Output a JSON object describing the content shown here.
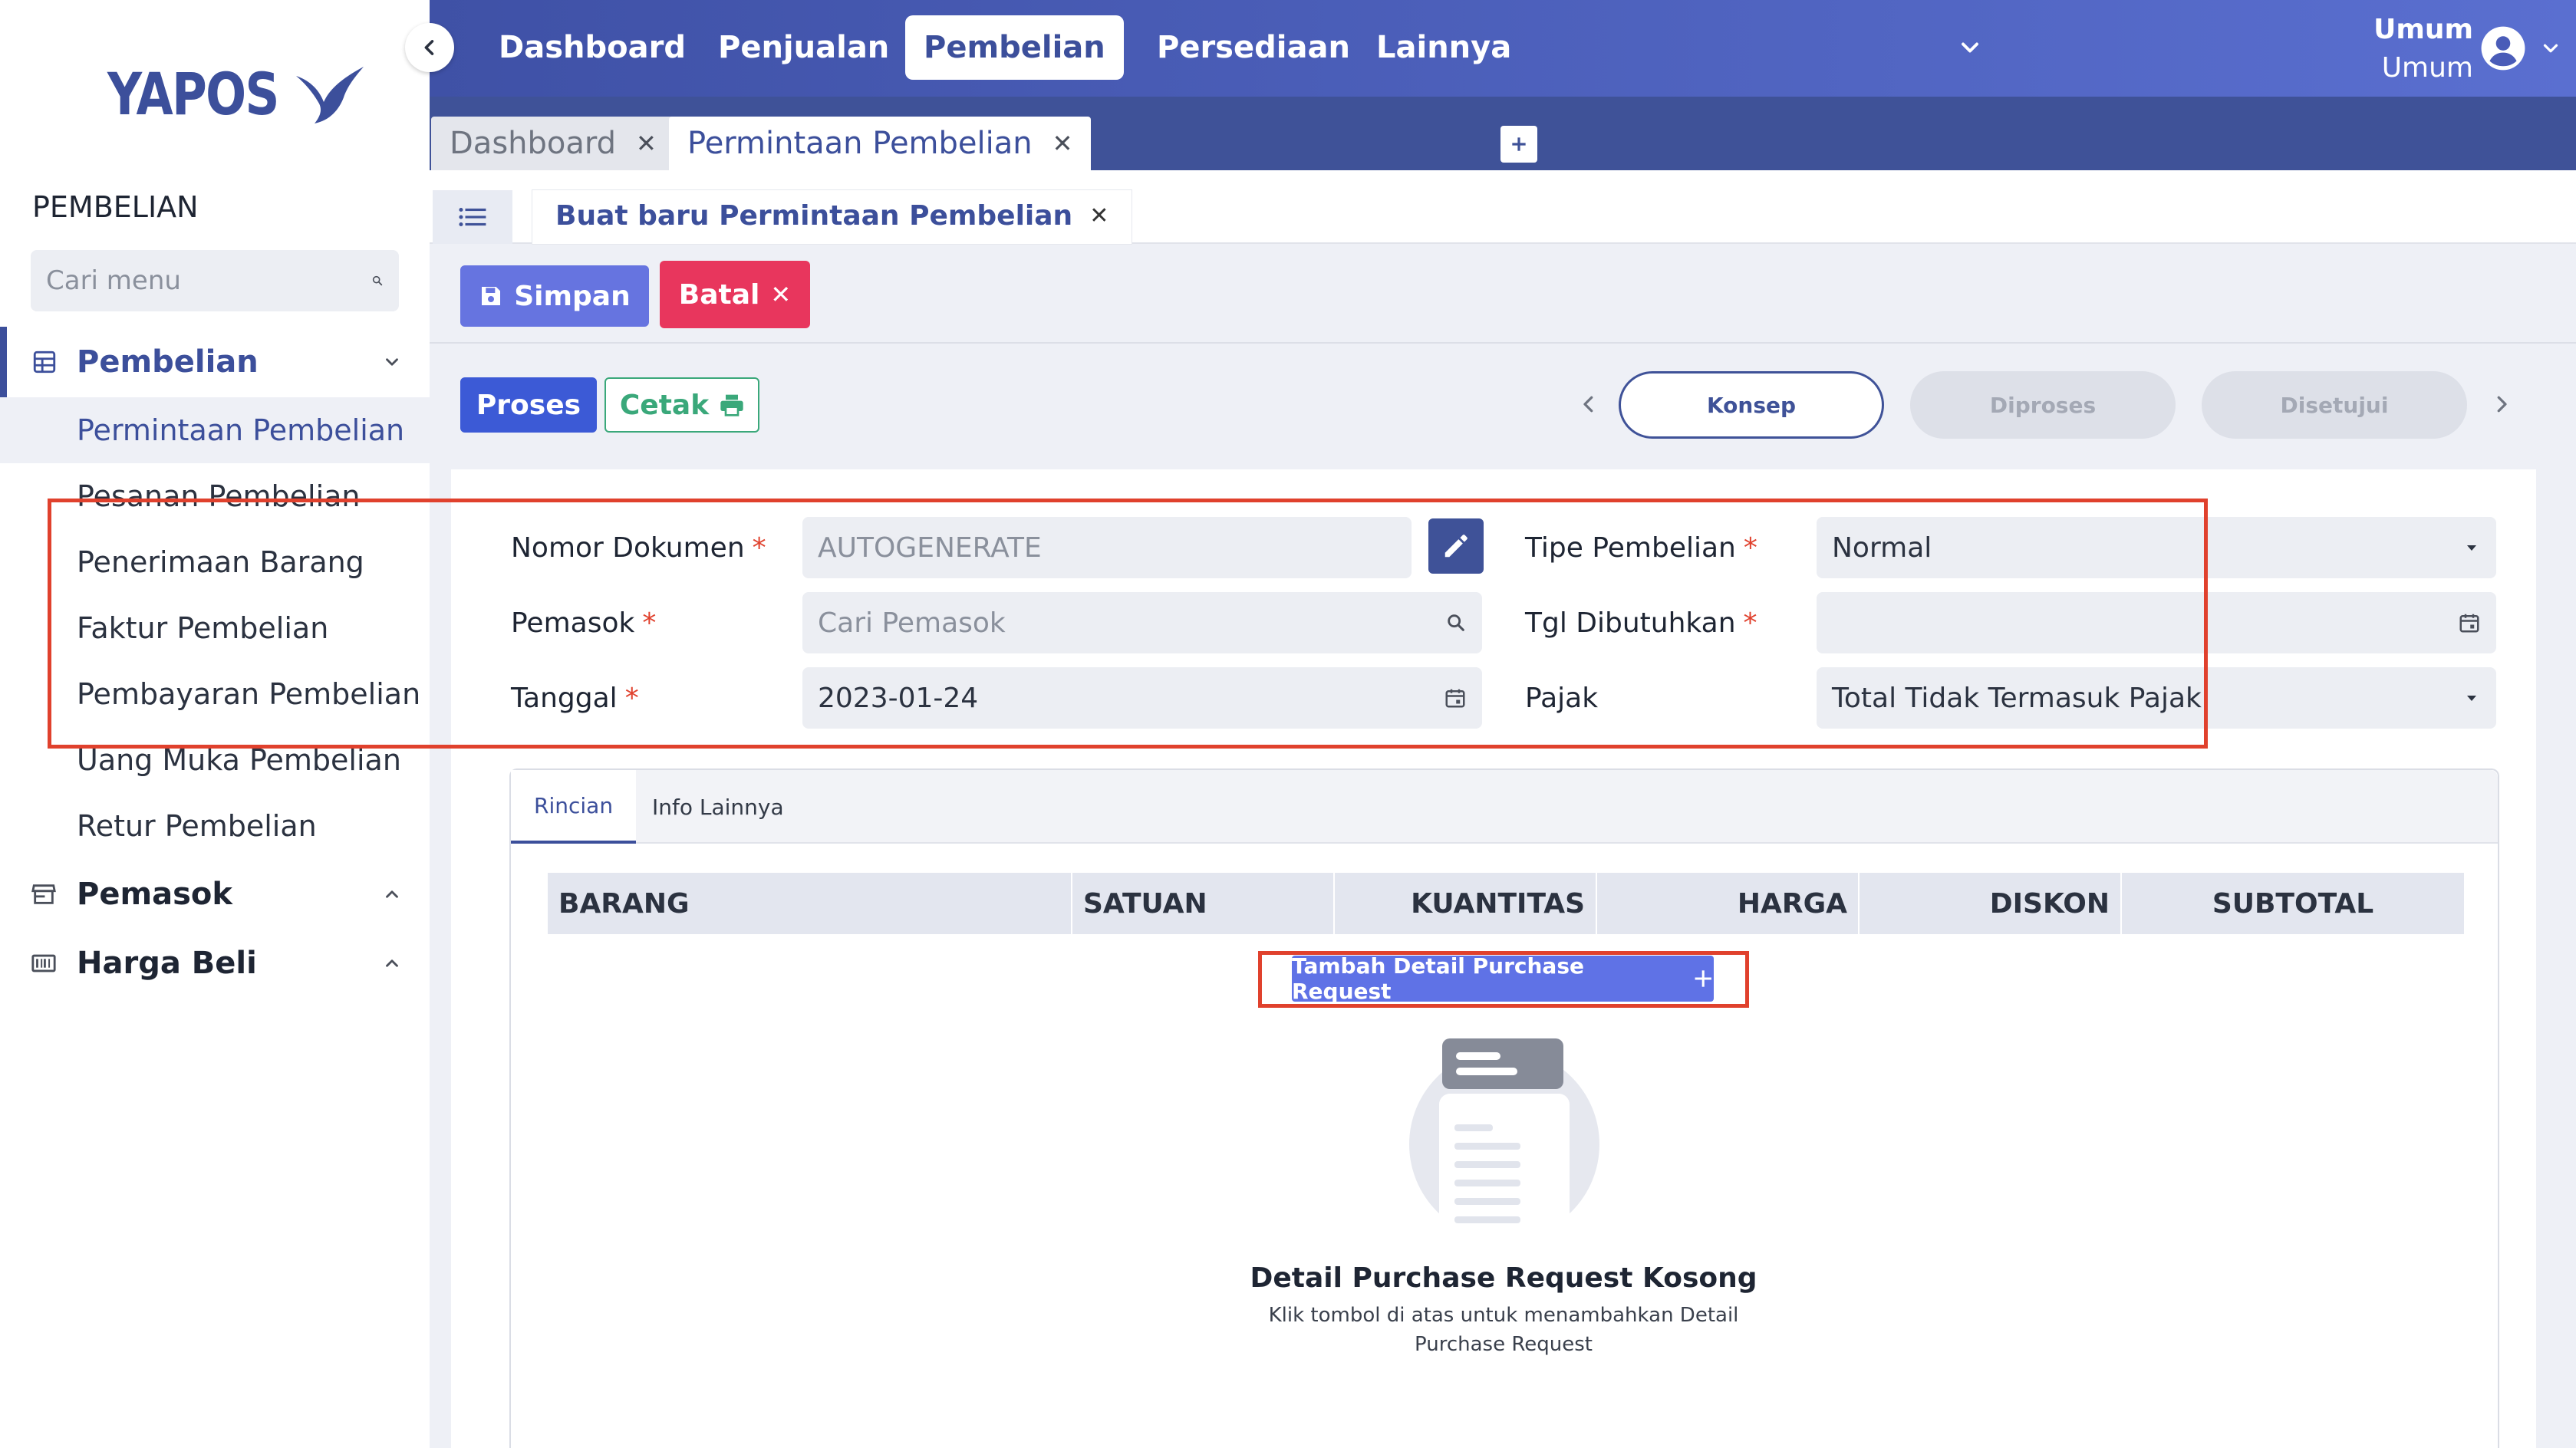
{
  "brand": {
    "name": "YAPOS"
  },
  "sidebar": {
    "section_title": "PEMBELIAN",
    "search_placeholder": "Cari menu",
    "groups": [
      {
        "label": "Pembelian",
        "icon": "grid-table-icon",
        "expanded": true
      },
      {
        "label": "Pemasok",
        "icon": "store-icon",
        "expanded": false
      },
      {
        "label": "Harga Beli",
        "icon": "barcode-icon",
        "expanded": false
      }
    ],
    "items": [
      {
        "label": "Permintaan Pembelian",
        "active": true
      },
      {
        "label": "Pesanan Pembelian"
      },
      {
        "label": "Penerimaan Barang"
      },
      {
        "label": "Faktur Pembelian"
      },
      {
        "label": "Pembayaran Pembelian"
      },
      {
        "label": "Uang Muka Pembelian"
      },
      {
        "label": "Retur Pembelian"
      }
    ]
  },
  "topnav": {
    "items": [
      {
        "label": "Dashboard"
      },
      {
        "label": "Penjualan"
      },
      {
        "label": "Pembelian",
        "active": true
      },
      {
        "label": "Persediaan"
      },
      {
        "label": "Lainnya"
      }
    ],
    "user": {
      "line1": "Umum",
      "line2": "Umum"
    }
  },
  "doc_tabs": [
    {
      "label": "Dashboard",
      "active": false
    },
    {
      "label": "Permintaan Pembelian",
      "active": true
    }
  ],
  "subtab": {
    "label": "Buat baru Permintaan Pembelian"
  },
  "actions": {
    "save": "Simpan",
    "cancel": "Batal",
    "process": "Proses",
    "print": "Cetak"
  },
  "workflow": {
    "steps": [
      {
        "label": "Konsep",
        "active": true
      },
      {
        "label": "Diproses",
        "active": false
      },
      {
        "label": "Disetujui",
        "active": false
      }
    ]
  },
  "form": {
    "nomor_dokumen": {
      "label": "Nomor Dokumen",
      "placeholder": "AUTOGENERATE"
    },
    "pemasok": {
      "label": "Pemasok",
      "placeholder": "Cari Pemasok"
    },
    "tanggal": {
      "label": "Tanggal",
      "value": "2023-01-24"
    },
    "tipe_pembelian": {
      "label": "Tipe Pembelian",
      "value": "Normal"
    },
    "tgl_dibutuhkan": {
      "label": "Tgl Dibutuhkan",
      "value": ""
    },
    "pajak": {
      "label": "Pajak",
      "value": "Total Tidak Termasuk Pajak"
    },
    "required_mark": "*"
  },
  "detail": {
    "tabs": [
      {
        "label": "Rincian",
        "active": true
      },
      {
        "label": "Info Lainnya"
      }
    ],
    "columns": [
      "BARANG",
      "SATUAN",
      "KUANTITAS",
      "HARGA",
      "DISKON",
      "SUBTOTAL"
    ],
    "add_button": "Tambah Detail Purchase Request",
    "empty_title": "Detail Purchase Request Kosong",
    "empty_subtitle": "Klik tombol di atas untuk menambahkan Detail Purchase Request"
  },
  "colors": {
    "primary": "#3f5298",
    "accent": "#5f72e6",
    "danger": "#e8365d",
    "success": "#3aa87a",
    "highlight": "#e0412d"
  }
}
